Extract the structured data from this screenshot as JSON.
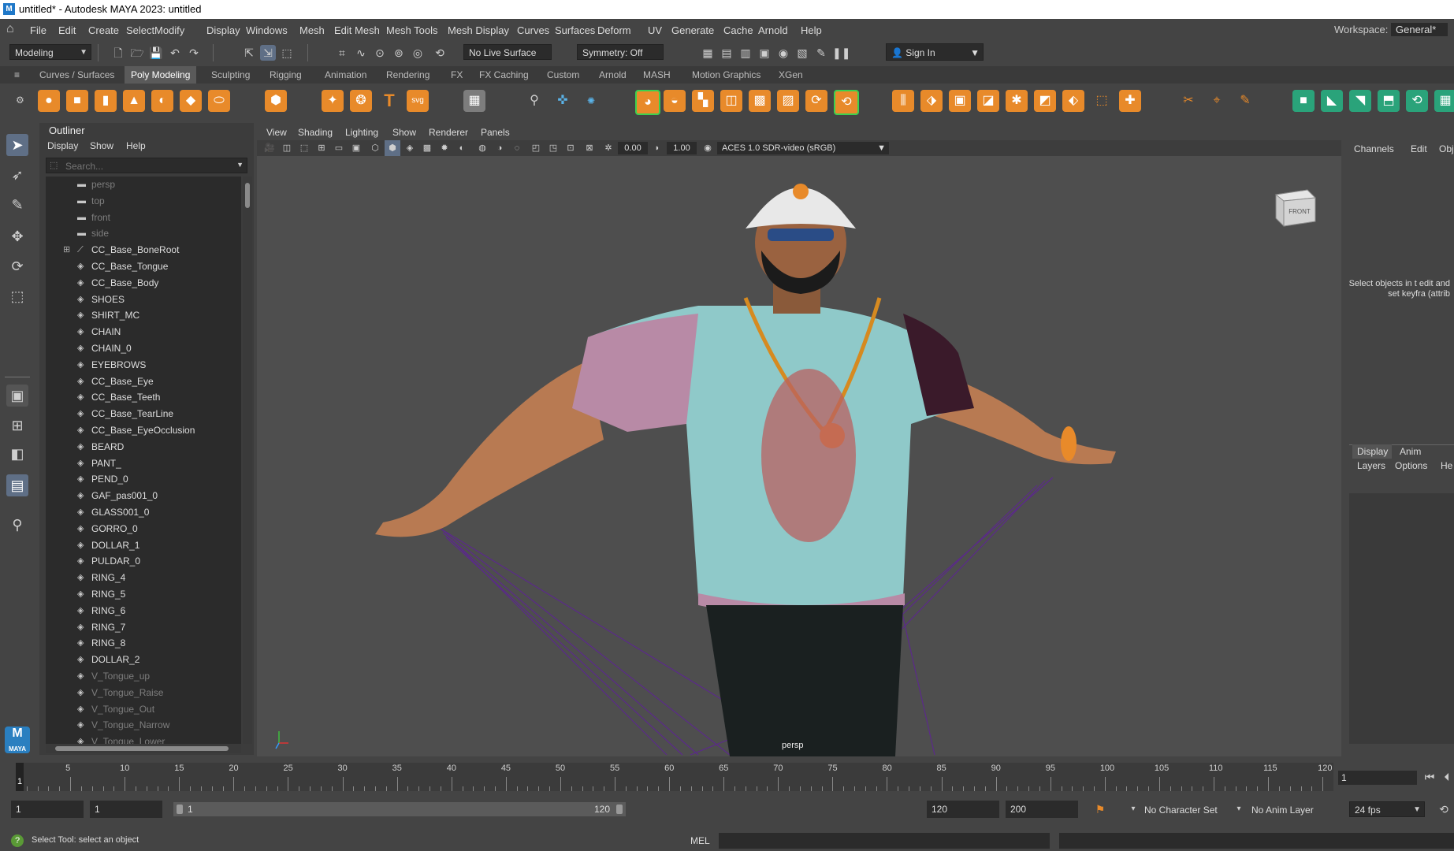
{
  "window": {
    "title": "untitled* - Autodesk MAYA 2023: untitled"
  },
  "menubar": {
    "items": [
      "File",
      "Edit",
      "Create",
      "Select",
      "Modify",
      "Display",
      "Windows",
      "Mesh",
      "Edit Mesh",
      "Mesh Tools",
      "Mesh Display",
      "Curves",
      "Surfaces",
      "Deform",
      "UV",
      "Generate",
      "Cache",
      "Arnold",
      "Help"
    ],
    "workspace_label": "Workspace:",
    "workspace_value": "General*"
  },
  "statusline": {
    "mode": "Modeling",
    "live_surface": "No Live Surface",
    "symmetry": "Symmetry: Off",
    "sign_in": "Sign In"
  },
  "shelf_tabs": [
    "Curves / Surfaces",
    "Poly Modeling",
    "Sculpting",
    "Rigging",
    "Animation",
    "Rendering",
    "FX",
    "FX Caching",
    "Custom",
    "Arnold",
    "MASH",
    "Motion Graphics",
    "XGen"
  ],
  "shelf_active": "Poly Modeling",
  "outliner": {
    "title": "Outliner",
    "menus": [
      "Display",
      "Show",
      "Help"
    ],
    "search_placeholder": "Search...",
    "items": [
      {
        "label": "persp",
        "icon": "camera-icon",
        "dim": true
      },
      {
        "label": "top",
        "icon": "camera-icon",
        "dim": true
      },
      {
        "label": "front",
        "icon": "camera-icon",
        "dim": true
      },
      {
        "label": "side",
        "icon": "camera-icon",
        "dim": true
      },
      {
        "label": "CC_Base_BoneRoot",
        "icon": "joint-icon",
        "dim": false,
        "expandable": true
      },
      {
        "label": "CC_Base_Tongue",
        "icon": "mesh-icon",
        "dim": false
      },
      {
        "label": "CC_Base_Body",
        "icon": "mesh-icon",
        "dim": false
      },
      {
        "label": "SHOES",
        "icon": "mesh-icon",
        "dim": false
      },
      {
        "label": "SHIRT_MC",
        "icon": "mesh-icon",
        "dim": false
      },
      {
        "label": "CHAIN",
        "icon": "mesh-icon",
        "dim": false
      },
      {
        "label": "CHAIN_0",
        "icon": "mesh-icon",
        "dim": false
      },
      {
        "label": "EYEBROWS",
        "icon": "mesh-icon",
        "dim": false
      },
      {
        "label": "CC_Base_Eye",
        "icon": "mesh-icon",
        "dim": false
      },
      {
        "label": "CC_Base_Teeth",
        "icon": "mesh-icon",
        "dim": false
      },
      {
        "label": "CC_Base_TearLine",
        "icon": "mesh-icon",
        "dim": false
      },
      {
        "label": "CC_Base_EyeOcclusion",
        "icon": "mesh-icon",
        "dim": false
      },
      {
        "label": "BEARD",
        "icon": "mesh-icon",
        "dim": false
      },
      {
        "label": "PANT_",
        "icon": "mesh-icon",
        "dim": false
      },
      {
        "label": "PEND_0",
        "icon": "mesh-icon",
        "dim": false
      },
      {
        "label": "GAF_pas001_0",
        "icon": "mesh-icon",
        "dim": false
      },
      {
        "label": "GLASS001_0",
        "icon": "mesh-icon",
        "dim": false
      },
      {
        "label": "GORRO_0",
        "icon": "mesh-icon",
        "dim": false
      },
      {
        "label": "DOLLAR_1",
        "icon": "mesh-icon",
        "dim": false
      },
      {
        "label": "PULDAR_0",
        "icon": "mesh-icon",
        "dim": false
      },
      {
        "label": "RING_4",
        "icon": "mesh-icon",
        "dim": false
      },
      {
        "label": "RING_5",
        "icon": "mesh-icon",
        "dim": false
      },
      {
        "label": "RING_6",
        "icon": "mesh-icon",
        "dim": false
      },
      {
        "label": "RING_7",
        "icon": "mesh-icon",
        "dim": false
      },
      {
        "label": "RING_8",
        "icon": "mesh-icon",
        "dim": false
      },
      {
        "label": "DOLLAR_2",
        "icon": "mesh-icon",
        "dim": false
      },
      {
        "label": "V_Tongue_up",
        "icon": "mesh-icon",
        "dim": true
      },
      {
        "label": "V_Tongue_Raise",
        "icon": "mesh-icon",
        "dim": true
      },
      {
        "label": "V_Tongue_Out",
        "icon": "mesh-icon",
        "dim": true
      },
      {
        "label": "V_Tongue_Narrow",
        "icon": "mesh-icon",
        "dim": true
      },
      {
        "label": "V_Tongue_Lower",
        "icon": "mesh-icon",
        "dim": true
      }
    ]
  },
  "viewport": {
    "menus": [
      "View",
      "Shading",
      "Lighting",
      "Show",
      "Renderer",
      "Panels"
    ],
    "exposure": "0.00",
    "gamma": "1.00",
    "colorspace": "ACES 1.0 SDR-video (sRGB)",
    "viewcube_label": "FRONT",
    "camera_label": "persp"
  },
  "channelbox": {
    "tabs": [
      "Channels",
      "Edit",
      "Obje"
    ],
    "hint": "Select objects in t edit and set keyfra (attrib",
    "layer_tabs": [
      "Display",
      "Anim"
    ],
    "layer_menus": [
      "Layers",
      "Options",
      "He"
    ]
  },
  "timeslider": {
    "ticks": [
      "5",
      "10",
      "15",
      "20",
      "25",
      "30",
      "35",
      "40",
      "45",
      "50",
      "55",
      "60",
      "65",
      "70",
      "75",
      "80",
      "85",
      "90",
      "95",
      "100",
      "105",
      "110",
      "115",
      "120"
    ],
    "current_frame_marker": "1",
    "current_frame": "1"
  },
  "range": {
    "start": "1",
    "playback_start": "1",
    "bar_start": "1",
    "bar_end": "120",
    "playback_end": "120",
    "end": "200",
    "character_set": "No Character Set",
    "anim_layer": "No Anim Layer",
    "fps": "24 fps"
  },
  "commandline": {
    "help_text": "Select Tool: select an object",
    "mel": "MEL"
  },
  "colors": {
    "ui_bg": "#444444",
    "panel_dark": "#2b2b2b",
    "accent_orange": "#e88a2a",
    "shirt": "#8fc9c9"
  }
}
